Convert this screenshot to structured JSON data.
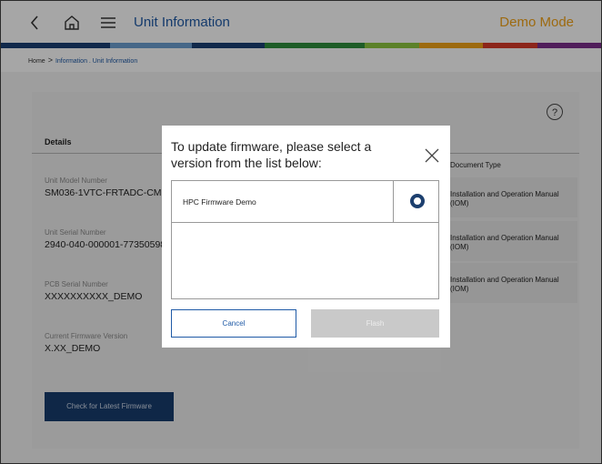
{
  "header": {
    "title": "Unit Information",
    "mode_label": "Demo Mode",
    "icons": [
      "back-icon",
      "home-icon",
      "menu-icon"
    ],
    "accent_color": "#1f5aa6",
    "mode_color": "#f2a31a",
    "stripe_colors": [
      "#1b3f73",
      "#6c9fd1",
      "#2e8e3d",
      "#8cc63f",
      "#f2a31a",
      "#d83b2a",
      "#7b2f8a",
      "#1b3f73"
    ]
  },
  "breadcrumb": {
    "home": "Home",
    "separator": ">",
    "path": "Information . Unit Information"
  },
  "details": {
    "heading": "Details",
    "fields": [
      {
        "label": "Unit Model Number",
        "value": "SM036-1VTC-FRTADC-CMGX"
      },
      {
        "label": "Unit Serial Number",
        "value": "2940-040-000001-77350598"
      },
      {
        "label": "PCB Serial Number",
        "value": "XXXXXXXXXX_DEMO"
      },
      {
        "label": "Current Firmware Version",
        "value": "X.XX_DEMO"
      }
    ],
    "check_button": "Check for Latest Firmware"
  },
  "documents": {
    "header": "Document Type",
    "rows": [
      "Installation and Operation Manual (IOM)",
      "Installation and Operation Manual (IOM)",
      "Installation and Operation Manual (IOM)"
    ]
  },
  "help_icon_glyph": "?",
  "modal": {
    "title": "To update firmware, please select a version from the list below:",
    "close_glyph": "×",
    "items": [
      {
        "label": "HPC Firmware Demo",
        "selected": false
      }
    ],
    "cancel_label": "Cancel",
    "flash_label": "Flash"
  }
}
